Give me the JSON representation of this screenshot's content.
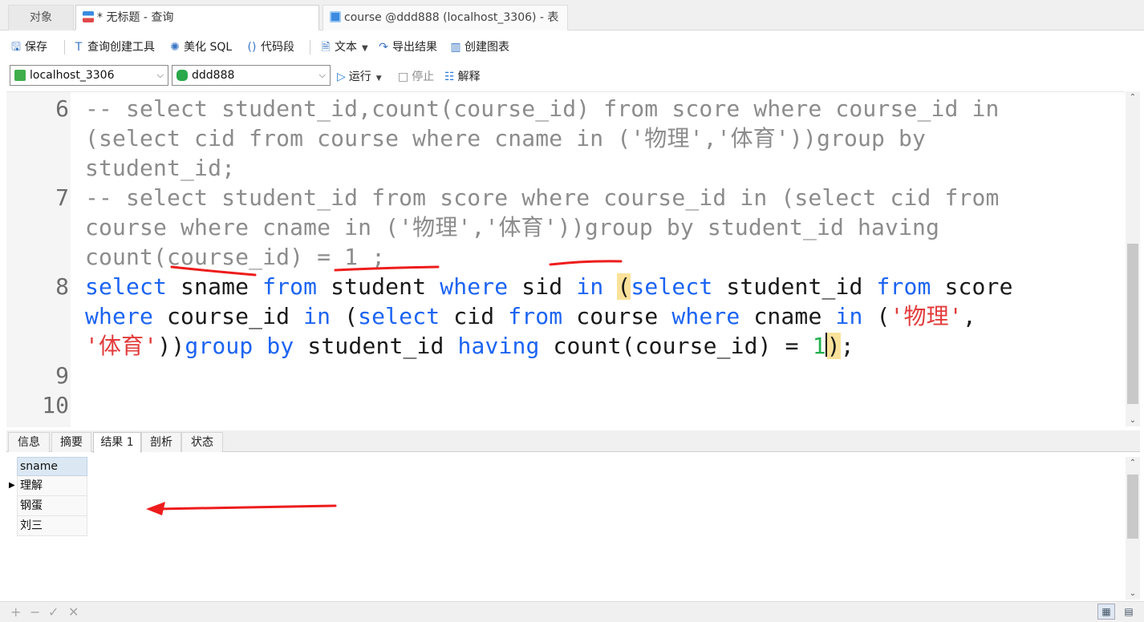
{
  "tabs": {
    "objects": "对象",
    "query": "* 无标题 - 查询",
    "table": "course @ddd888 (localhost_3306) - 表"
  },
  "toolbar": {
    "save": "保存",
    "query_builder": "查询创建工具",
    "beautify": "美化 SQL",
    "snippet": "代码段",
    "text": "文本",
    "export": "导出结果",
    "chart": "创建图表"
  },
  "selectors": {
    "connection": "localhost_3306",
    "database": "ddd888",
    "run": "运行",
    "stop": "停止",
    "explain": "解释"
  },
  "editor": {
    "line_numbers": [
      "6",
      "7",
      "8",
      "9",
      "10"
    ],
    "line6_a": "-- select student_id,count(course_id) from score where course_id in",
    "line6_b": "(select cid from course where cname in ('物理','体育'))group by",
    "line6_c": "student_id;",
    "line7_a": "-- select student_id from score where course_id in (select cid from",
    "line7_b": "course where cname in ('物理','体育'))group by student_id having",
    "line7_c": "count(course_id) = 1 ;",
    "line8": {
      "t1": "select",
      "t2": " sname ",
      "t3": "from",
      "t4": " student ",
      "t5": "where",
      "t6": " sid ",
      "t7": "in",
      "t8": " ",
      "t9": "(",
      "t10": "select",
      "t11": " student_id ",
      "t12": "from",
      "t13": " score",
      "u1": "where",
      "u2": " course_id ",
      "u3": "in",
      "u4": " (",
      "u5": "select",
      "u6": " cid ",
      "u7": "from",
      "u8": " course ",
      "u9": "where",
      "u10": " cname ",
      "u11": "in",
      "u12": " (",
      "u13": "'物理'",
      "u14": ",",
      "v1": "'体育'",
      "v2": "))",
      "v3": "group by",
      "v4": " student_id ",
      "v5": "having",
      "v6": " count(course_id) = ",
      "v7": "1",
      "v8": ")",
      "v9": ";"
    }
  },
  "result_tabs": [
    "信息",
    "摘要",
    "结果 1",
    "剖析",
    "状态"
  ],
  "result_grid": {
    "column": "sname",
    "rows": [
      "理解",
      "钢蛋",
      "刘三"
    ]
  },
  "footer_icons": [
    "add-icon",
    "remove-icon",
    "confirm-icon",
    "cancel-icon"
  ],
  "colors": {
    "keyword": "#1c64f2",
    "string": "#e23b3b",
    "number": "#22b14c",
    "comment": "#8c8c8c",
    "annotation": "#ee1c1c"
  }
}
